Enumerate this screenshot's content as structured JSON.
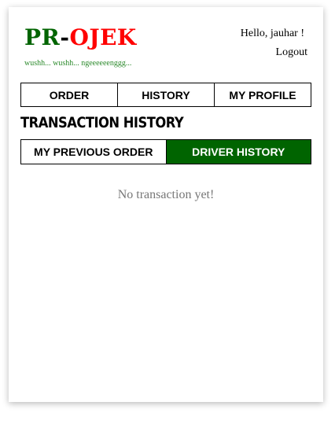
{
  "header": {
    "logo": {
      "part1": "PR",
      "part2": "-",
      "part3": "OJEK"
    },
    "tagline": "wushh... wushh... ngeeeeeenggg...",
    "greeting": "Hello, jauhar !",
    "logout_label": "Logout"
  },
  "nav": {
    "items": [
      {
        "label": "ORDER"
      },
      {
        "label": "HISTORY"
      },
      {
        "label": "MY PROFILE"
      }
    ]
  },
  "page": {
    "title": "TRANSACTION HISTORY"
  },
  "tabs": {
    "items": [
      {
        "label": "MY PREVIOUS ORDER",
        "active": false
      },
      {
        "label": "DRIVER HISTORY",
        "active": true
      }
    ]
  },
  "content": {
    "empty_message": "No transaction yet!"
  },
  "colors": {
    "brand_green": "#006400",
    "brand_red": "#ff0000",
    "tagline_green": "#2e8b2e",
    "muted_text": "#777777"
  }
}
